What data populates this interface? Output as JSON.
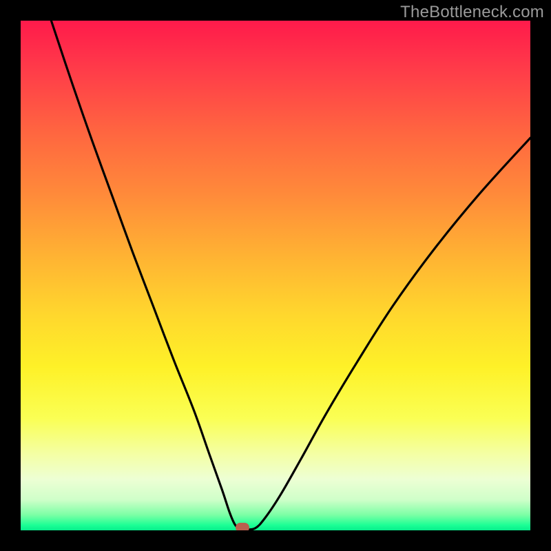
{
  "watermark": "TheBottleneck.com",
  "colors": {
    "frame": "#000000",
    "curve": "#000000",
    "marker": "#b9604e",
    "gradient_top": "#ff1a4b",
    "gradient_bottom": "#07ee8c"
  },
  "chart_data": {
    "type": "line",
    "title": "",
    "xlabel": "",
    "ylabel": "",
    "xlim": [
      0,
      100
    ],
    "ylim": [
      0,
      100
    ],
    "grid": false,
    "legend": false,
    "series": [
      {
        "name": "bottleneck-curve",
        "x": [
          6,
          10,
          14,
          18,
          22,
          26,
          30,
          34,
          37,
          39.5,
          41,
          42,
          43,
          44,
          46,
          48,
          51,
          55,
          60,
          66,
          73,
          81,
          90,
          100
        ],
        "y": [
          100,
          88,
          76.5,
          65.5,
          54.5,
          44,
          33.5,
          23.5,
          15,
          8,
          3.5,
          1.2,
          0.2,
          0.2,
          0.4,
          2.5,
          7,
          14,
          23,
          33,
          44,
          55,
          66,
          77
        ]
      }
    ],
    "annotations": [
      {
        "name": "min-marker",
        "x": 43.5,
        "y": 0.5
      }
    ]
  }
}
